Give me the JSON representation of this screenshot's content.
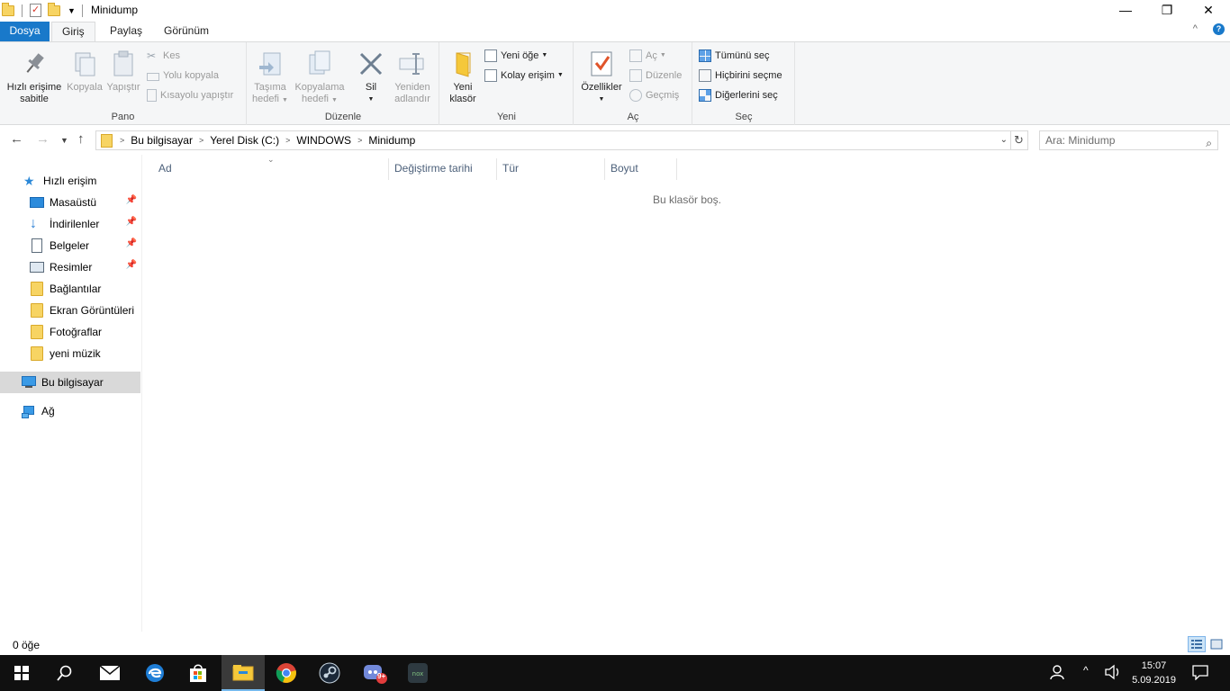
{
  "window": {
    "title": "Minidump",
    "minimize": "—",
    "restore": "❐",
    "close": "✕"
  },
  "tabs": {
    "file": "Dosya",
    "home": "Giriş",
    "share": "Paylaş",
    "view": "Görünüm",
    "collapse": "^",
    "help": "?"
  },
  "ribbon": {
    "clipboard": {
      "label": "Pano",
      "pin": "Hızlı erişime sabitle",
      "pin_line1": "Hızlı erişime",
      "pin_line2": "sabitle",
      "copy": "Kopyala",
      "paste": "Yapıştır",
      "cut": "Kes",
      "copy_path": "Yolu kopyala",
      "paste_shortcut": "Kısayolu yapıştır"
    },
    "organize": {
      "label": "Düzenle",
      "move_line1": "Taşıma",
      "move_line2": "hedefi",
      "copyto_line1": "Kopyalama",
      "copyto_line2": "hedefi",
      "delete": "Sil",
      "rename_line1": "Yeniden",
      "rename_line2": "adlandır"
    },
    "new": {
      "label": "Yeni",
      "new_folder_line1": "Yeni",
      "new_folder_line2": "klasör",
      "new_item": "Yeni öğe",
      "easy_access": "Kolay erişim"
    },
    "open": {
      "label": "Aç",
      "properties": "Özellikler",
      "open": "Aç",
      "edit": "Düzenle",
      "history": "Geçmiş"
    },
    "select": {
      "label": "Seç",
      "select_all": "Tümünü seç",
      "select_none": "Hiçbirini seçme",
      "invert": "Diğerlerini seç"
    }
  },
  "address": {
    "crumbs": [
      "Bu bilgisayar",
      "Yerel Disk (C:)",
      "WINDOWS",
      "Minidump"
    ],
    "search_placeholder": "Ara: Minidump"
  },
  "nav": {
    "quick_access": "Hızlı erişim",
    "items": [
      {
        "label": "Masaüstü",
        "pinned": true
      },
      {
        "label": "İndirilenler",
        "pinned": true
      },
      {
        "label": "Belgeler",
        "pinned": true
      },
      {
        "label": "Resimler",
        "pinned": true
      },
      {
        "label": "Bağlantılar",
        "pinned": false
      },
      {
        "label": "Ekran Görüntüleri",
        "pinned": false
      },
      {
        "label": "Fotoğraflar",
        "pinned": false
      },
      {
        "label": "yeni müzik",
        "pinned": false
      }
    ],
    "this_pc": "Bu bilgisayar",
    "network": "Ağ"
  },
  "columns": {
    "name": "Ad",
    "date": "Değiştirme tarihi",
    "type": "Tür",
    "size": "Boyut"
  },
  "empty_message": "Bu klasör boş.",
  "status": {
    "count": "0 öğe"
  },
  "taskbar": {
    "time": "15:07",
    "date": "5.09.2019",
    "badge": "9+"
  },
  "colors": {
    "accent": "#1979ca",
    "taskbar": "#101010",
    "folder": "#f7d463"
  }
}
